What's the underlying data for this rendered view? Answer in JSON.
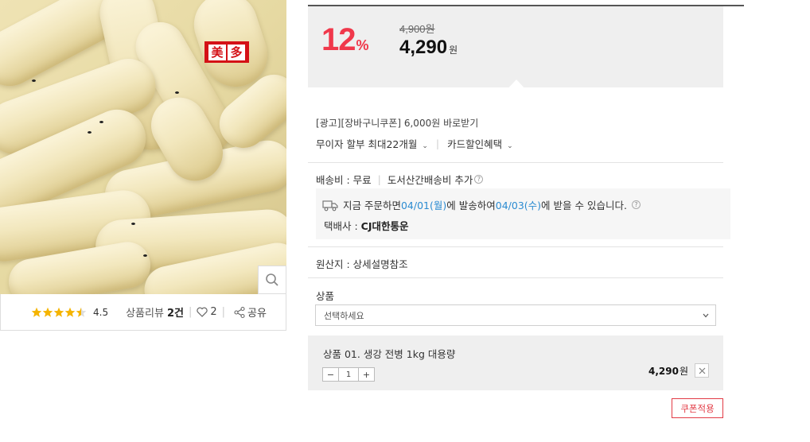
{
  "product_image": {
    "brand_badge": [
      "美",
      "多"
    ],
    "zoom_icon": "magnifier-icon"
  },
  "review_bar": {
    "rating_stars": 4.5,
    "rating_text": "4.5",
    "review_label": "상품리뷰",
    "review_count": "2건",
    "likes_count": "2",
    "share_label": "공유"
  },
  "price_box": {
    "discount_rate": "12",
    "discount_unit": "%",
    "original_price": "4,900원",
    "price": "4,290",
    "price_unit": "원"
  },
  "benefits": {
    "ad_text": "[광고][장바구니쿠폰] 6,000원 바로받기",
    "installment": "무이자 할부 최대22개월",
    "card_discount": "카드할인혜택"
  },
  "shipping": {
    "fee_text": "배송비 : 무료",
    "extra_text": "도서산간배송비 추가",
    "delivery_prefix": "지금 주문하면 ",
    "ship_date": "04/01(월)",
    "delivery_mid": "에 발송하여 ",
    "arrive_date": "04/03(수)",
    "delivery_suffix": "에 받을 수 있습니다.",
    "carrier_label": "택배사 : ",
    "carrier_name": "CJ대한통운"
  },
  "origin": "원산지 : 상세설명참조",
  "options": {
    "label": "상품",
    "select_placeholder": "선택하세요"
  },
  "selected_item": {
    "name": "상품 01. 생강 전병 1kg 대용량",
    "quantity": "1",
    "price": "4,290",
    "price_unit": "원"
  },
  "coupon_button": "쿠폰적용",
  "colors": {
    "discount": "#f0384b",
    "link_blue": "#2b8bd1",
    "star": "#f5b400"
  }
}
